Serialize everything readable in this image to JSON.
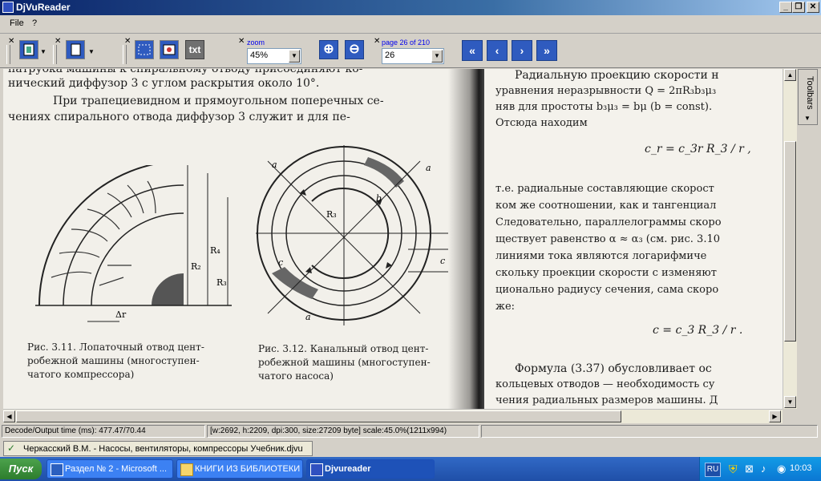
{
  "window": {
    "title": "DjVuReader",
    "min": "_",
    "max": "❐",
    "close": "✕"
  },
  "menu": {
    "items": [
      "File",
      "?"
    ]
  },
  "toolbar": {
    "txt_label": "txt",
    "zoom_label": "zoom",
    "zoom_value": "45%",
    "page_label": "page 26 of 210",
    "page_value": "26",
    "nav": [
      "«",
      "‹",
      "›",
      "»"
    ]
  },
  "document": {
    "left_lines": [
      "патрубка машины к спиральному отводу присоединяют ко-",
      "нический диффузор 3 с углом раскрытия около 10°.",
      "При трапециевидном и прямоугольном поперечных се-",
      "чениях спирального отвода диффузор 3 служит и для пе-"
    ],
    "fig1_caption": [
      "Рис. 3.11. Лопаточный отвод цент-",
      "робежной машины (многоступен-",
      "чатого компрессора)"
    ],
    "fig2_caption": [
      "Рис. 3.12. Канальный отвод цент-",
      "робежной машины (многоступен-",
      "чатого насоса)"
    ],
    "fig1_labels": {
      "r2": "R₂",
      "r4": "R₄",
      "r3": "R₃",
      "dr": "Δr"
    },
    "fig2_labels": {
      "a1": "a",
      "a2": "a",
      "a3": "a",
      "b": "b",
      "c1": "c",
      "c2": "c",
      "r3": "R₃"
    },
    "right_lines": [
      "Радиальную проекцию скорости н",
      "уравнения неразрывности   Q = 2πR₃b₃μ₃",
      "няв для простоты b₃μ₃ = bμ  (b = const).",
      "Отсюда находим",
      "т.е. радиальные составляющие скорост",
      "ком же соотношении, как и тангенциал",
      "Следовательно, параллелограммы скоро",
      "ществует равенство α ≈ α₃  (см. рис. 3.10",
      "линиями тока являются логарифмиче",
      "скольку проекции скорости c изменяют",
      "ционально радиусу сечения, сама скоро",
      "же:",
      "Формула (3.37)  обусловливает  ос",
      "кольцевых отводов — необходимость су",
      "чения радиальных размеров машины. Д"
    ],
    "formula1": "c_r = c_3r R_3 / r ,",
    "formula2": "c = c_3 R_3 / r ."
  },
  "toolbars_tab": "Toolbars",
  "status": {
    "decode": "Decode/Output time (ms): 477.47/70.44",
    "info": "[w:2692, h:2209, dpi:300, size:27209 byte] scale:45.0%(1211x994)"
  },
  "file_tab": "Черкасский В.М. - Насосы, вентиляторы, компрессоры Учебник.djvu",
  "taskbar": {
    "start": "Пуск",
    "buttons": [
      "Раздел № 2 - Microsoft ...",
      "КНИГИ ИЗ БИБЛИОТЕКИ",
      "Djvureader"
    ],
    "lang": "RU",
    "clock": "10:03"
  }
}
